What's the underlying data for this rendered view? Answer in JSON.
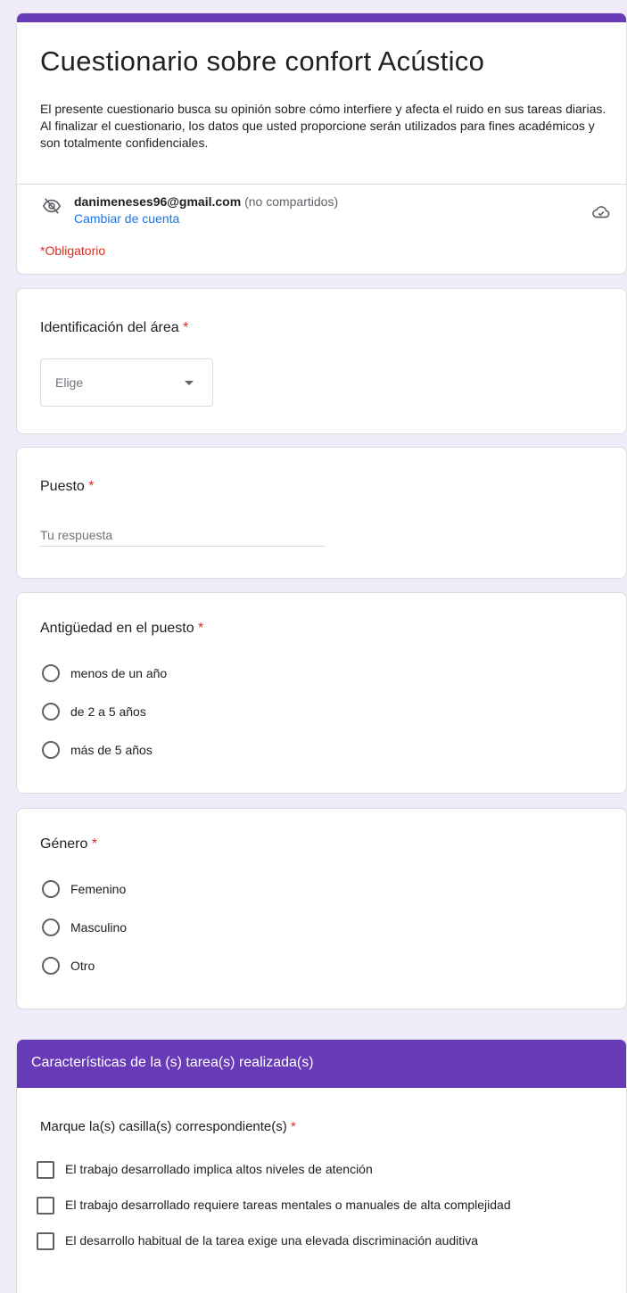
{
  "form": {
    "title": "Cuestionario sobre confort Acústico",
    "description": "El presente cuestionario busca su opinión sobre cómo interfiere y afecta el ruido en sus tareas diarias.\n Al finalizar el cuestionario, los datos que usted proporcione serán utilizados para  fines académicos y son totalmente confidenciales.",
    "account_email": "danimeneses96@gmail.com",
    "account_note": "(no compartidos)",
    "switch_account": "Cambiar de cuenta",
    "required_note": "*Obligatorio"
  },
  "questions": {
    "area": {
      "label": "Identificación del área",
      "required_mark": "*",
      "dropdown_value": "Elige"
    },
    "puesto": {
      "label": "Puesto",
      "required_mark": "*",
      "placeholder": "Tu respuesta"
    },
    "antiguedad": {
      "label": "Antigüedad en el puesto",
      "required_mark": "*",
      "options": [
        "menos de un año",
        "de 2 a 5 años",
        "más de 5 años"
      ]
    },
    "genero": {
      "label": "Género",
      "required_mark": "*",
      "options": [
        "Femenino",
        "Masculino",
        "Otro"
      ]
    }
  },
  "section": {
    "title": "Características de la (s) tarea(s) realizada(s)",
    "question_label": "Marque la(s) casilla(s) correspondiente(s)",
    "required_mark": "*",
    "checkboxes": [
      "El trabajo desarrollado implica altos niveles de atención",
      "El trabajo desarrollado requiere tareas mentales o manuales de alta complejidad",
      "El desarrollo habitual de la tarea exige una elevada discriminación auditiva"
    ]
  },
  "colors": {
    "accent": "#673ab7",
    "required": "#d93025",
    "link": "#1a73e8",
    "page_bg": "#f0ebf8"
  },
  "icons": {
    "account_privacy": "eye-off-icon",
    "save_status": "cloud-check-icon",
    "dropdown": "caret-down-icon"
  }
}
